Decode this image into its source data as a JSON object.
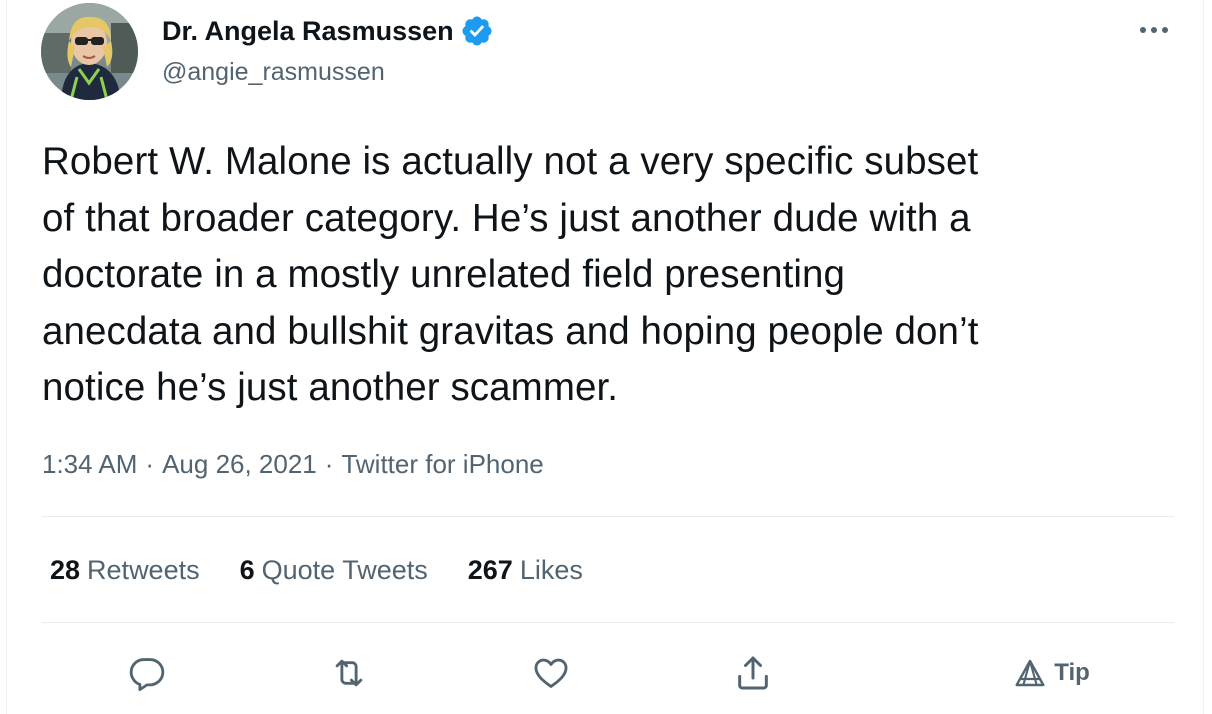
{
  "author": {
    "name": "Dr. Angela Rasmussen",
    "handle": "@angie_rasmussen",
    "verified": true
  },
  "tweet": {
    "text": "Robert W. Malone is actually not a very specific subset\nof that broader category. He’s just another dude with a\ndoctorate in a mostly unrelated field presenting\nanecdata and bullshit gravitas and hoping people don’t\nnotice he’s just another scammer.",
    "time": "1:34 AM",
    "date": "Aug 26, 2021",
    "source": "Twitter for iPhone",
    "separator": "·"
  },
  "stats": {
    "retweets": {
      "count": "28",
      "label": "Retweets"
    },
    "quote_tweets": {
      "count": "6",
      "label": "Quote Tweets"
    },
    "likes": {
      "count": "267",
      "label": "Likes"
    }
  },
  "actions": {
    "reply_icon": "reply-icon",
    "retweet_icon": "retweet-icon",
    "like_icon": "heart-icon",
    "share_icon": "share-icon",
    "tip_icon": "tip-icon",
    "tip_label": "Tip"
  },
  "colors": {
    "text": "#0f1419",
    "secondary": "#536471",
    "verified": "#1d9bf0",
    "divider": "#e6ecf0"
  }
}
